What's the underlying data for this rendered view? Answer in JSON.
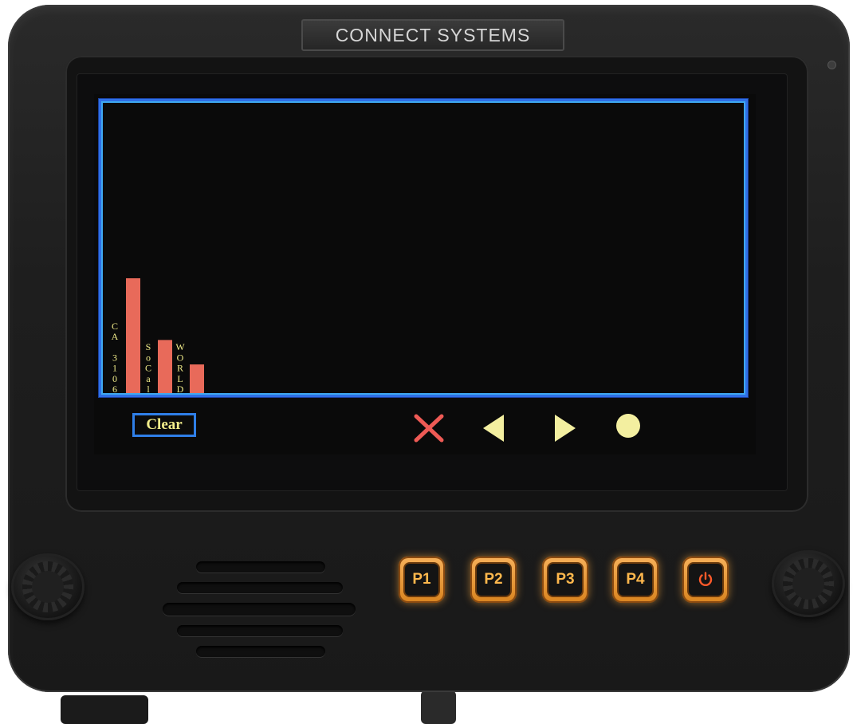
{
  "device": {
    "brand": "CONNECT SYSTEMS"
  },
  "chart_data": {
    "type": "bar",
    "categories": [
      "CA 3106",
      "SoCal",
      "WORLD"
    ],
    "category_labels_vertical": [
      [
        "C",
        "A",
        " ",
        "3",
        "1",
        "0",
        "6"
      ],
      [
        "S",
        "o",
        "C",
        "a",
        "l"
      ],
      [
        "W",
        "O",
        "R",
        "L",
        "D"
      ]
    ],
    "values": [
      100,
      47,
      26
    ],
    "title": "",
    "xlabel": "",
    "ylabel": "",
    "ylim": [
      0,
      250
    ],
    "grid": false,
    "legend": "none",
    "bar_color": "#e86a5a",
    "label_color": "#f2ed8a",
    "frame_color": "#2f6fe6"
  },
  "toolbar": {
    "clear_label": "Clear",
    "close_icon": "close-icon",
    "prev_icon": "triangle-left-icon",
    "next_icon": "triangle-right-icon",
    "record_icon": "circle-icon",
    "close_color": "#ee5a55",
    "arrow_color": "#f3efa0"
  },
  "hardware_buttons": [
    {
      "label": "P1"
    },
    {
      "label": "P2"
    },
    {
      "label": "P3"
    },
    {
      "label": "P4"
    },
    {
      "label": "",
      "icon": "power-icon"
    }
  ],
  "colors": {
    "accent": "#2f6fe6",
    "button_glow": "#ffa93c"
  }
}
